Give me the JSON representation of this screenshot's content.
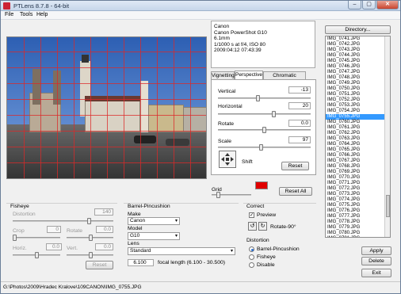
{
  "window": {
    "title": "PTLens 8.7.8 - 64-bit",
    "minimize": "–",
    "maximize": "▢",
    "close": "✕"
  },
  "menu": [
    "File",
    "Tools",
    "Help"
  ],
  "info": {
    "lines": [
      "Canon",
      "Canon PowerShot G10",
      "6.1mm",
      "1/1000 s at f/4, ISO 80",
      "2009:04:12 07:43:39"
    ]
  },
  "tabs": [
    "Vignetting",
    "Perspective",
    "Chromatic Aberration"
  ],
  "perspective": {
    "vertical_label": "Vertical",
    "vertical_value": "-13",
    "horizontal_label": "Horizontal",
    "horizontal_value": "20",
    "rotate_label": "Rotate",
    "rotate_value": "0.0",
    "scale_label": "Scale",
    "scale_value": "97",
    "shift_label": "Shift",
    "reset_label": "Reset"
  },
  "grid": {
    "label": "Grid",
    "color": "#e00000",
    "reset_all_label": "Reset All"
  },
  "directory_label": "Directory...",
  "files": {
    "items": [
      "IMG_0741.JPG",
      "IMG_0742.JPG",
      "IMG_0743.JPG",
      "IMG_0744.JPG",
      "IMG_0745.JPG",
      "IMG_0746.JPG",
      "IMG_0747.JPG",
      "IMG_0748.JPG",
      "IMG_0749.JPG",
      "IMG_0750.JPG",
      "IMG_0751.JPG",
      "IMG_0752.JPG",
      "IMG_0753.JPG",
      "IMG_0754.JPG",
      "IMG_0755.JPG",
      "IMG_0760.JPG",
      "IMG_0761.JPG",
      "IMG_0762.JPG",
      "IMG_0763.JPG",
      "IMG_0764.JPG",
      "IMG_0765.JPG",
      "IMG_0766.JPG",
      "IMG_0767.JPG",
      "IMG_0768.JPG",
      "IMG_0769.JPG",
      "IMG_0770.JPG",
      "IMG_0771.JPG",
      "IMG_0772.JPG",
      "IMG_0773.JPG",
      "IMG_0774.JPG",
      "IMG_0775.JPG",
      "IMG_0776.JPG",
      "IMG_0777.JPG",
      "IMG_0778.JPG",
      "IMG_0779.JPG",
      "IMG_0780.JPG",
      "IMG_0781.JPG",
      "IMG_0782.JPG"
    ],
    "selected": "IMG_0755.JPG"
  },
  "fisheye": {
    "title": "Fisheye",
    "distortion_label": "Distortion",
    "distortion_value": "140",
    "crop_label": "Crop",
    "crop_value": "0",
    "rotate_label": "Rotate",
    "rotate_value": "0.0",
    "horiz_label": "Horiz.",
    "horiz_value": "0.0",
    "vert_label": "Vert.",
    "vert_value": "0.0",
    "reset_label": "Reset"
  },
  "barrel": {
    "title": "Barrel-Pincushion",
    "make_label": "Make",
    "make_value": "Canon",
    "model_label": "Model",
    "model_value": "G10",
    "lens_label": "Lens",
    "lens_value": "Standard",
    "focal_value": "6.100",
    "focal_label": "focal length (6.100 - 30.500)"
  },
  "correct": {
    "title": "Correct",
    "preview_label": "Preview",
    "preview_checked": "✓",
    "rotate_label": "Rotate-90°",
    "distortion_title": "Distortion",
    "options": [
      "Barrel-Pincushion",
      "Fisheye",
      "Disable"
    ]
  },
  "actions": {
    "apply": "Apply",
    "delete": "Delete",
    "exit": "Exit"
  },
  "status": {
    "path": "G:\\Photos\\2009\\Hradec Kralove\\109CANON\\IMG_0755.JPG"
  }
}
